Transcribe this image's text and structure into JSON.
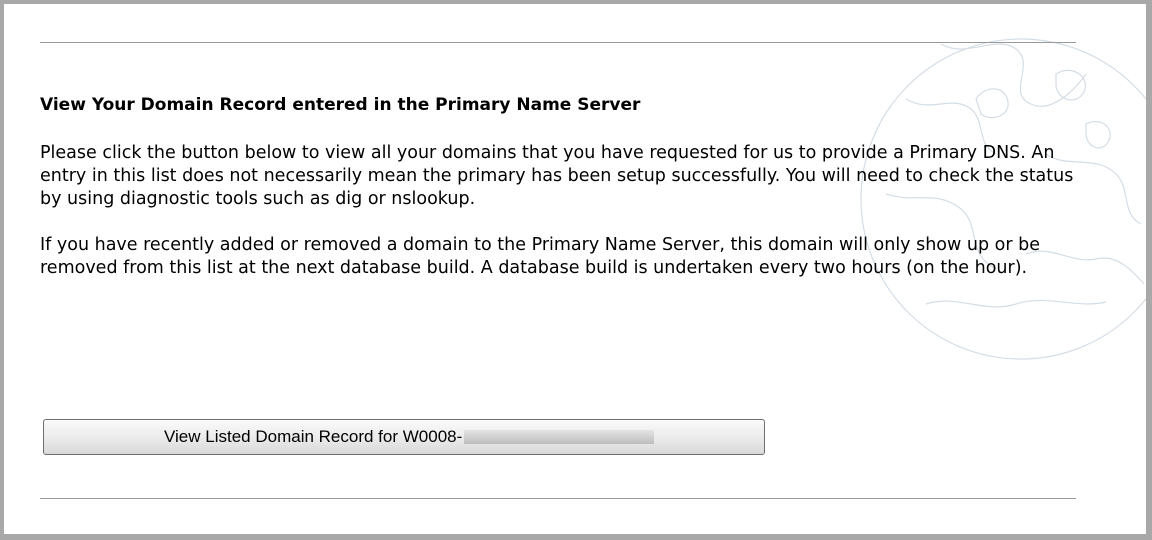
{
  "section": {
    "heading": "View Your Domain Record entered in the Primary Name Server",
    "paragraph1": "Please click the button below to view all your domains that you have requested for us to provide a Primary DNS. An entry in this list does not necessarily mean the primary has been setup successfully. You will need to check the status by using diagnostic tools such as dig or nslookup.",
    "paragraph2": "If you have recently added or removed a domain to the Primary Name Server, this domain will only show up or be removed from this list at the next database build. A database build is undertaken every two hours (on the hour)."
  },
  "button": {
    "label": "View Listed Domain Record for W0008-"
  },
  "colors": {
    "border": "#a8a8a8",
    "rule": "#9a9a9a",
    "globe_outline": "#d4dde6"
  },
  "icons": {
    "background": "globe-watermark-icon"
  }
}
